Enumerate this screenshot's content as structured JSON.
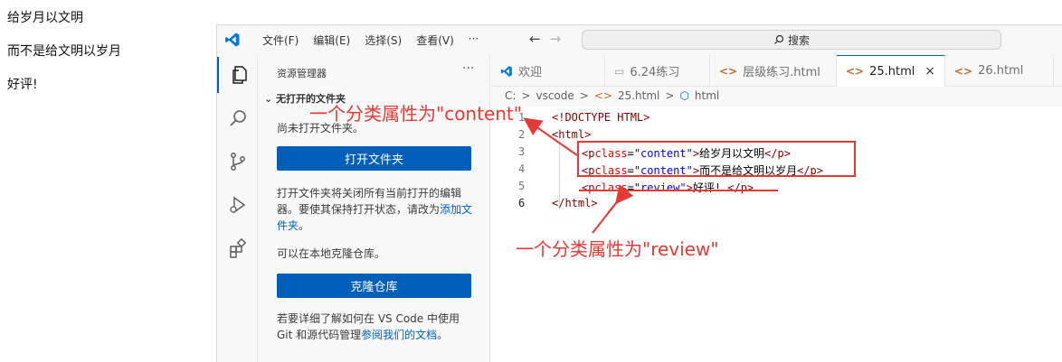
{
  "page": {
    "lines": [
      "给岁月以文明",
      "而不是给文明以岁月",
      "好评!"
    ]
  },
  "titlebar": {
    "menu": [
      "文件(F)",
      "编辑(E)",
      "选择(S)",
      "查看(V)",
      "···"
    ],
    "search_label": "搜索"
  },
  "activitybar": {
    "icons": [
      "explorer-icon",
      "search-icon",
      "source-control-icon",
      "run-debug-icon",
      "extensions-icon"
    ]
  },
  "sidebar": {
    "title": "资源管理器",
    "more": "···",
    "section": "无打开的文件夹",
    "no_folder_text": "尚未打开文件夹。",
    "open_folder_button": "打开文件夹",
    "info_text": "打开文件夹将关闭所有当前打开的编辑器。要使其保持打开状态，请改为",
    "add_folder_link": "添加文件夹",
    "add_folder_suffix": "。",
    "clone_text": "可以在本地克隆仓库。",
    "clone_button": "克隆仓库",
    "learn_text": "若要详细了解如何在 VS Code 中使用 Git 和源代码管理",
    "docs_link": "参阅我们的文档",
    "docs_suffix": "。"
  },
  "tabs": [
    {
      "label": "欢迎",
      "icon": "vscode-logo-icon",
      "active": false
    },
    {
      "label": "6.24练习",
      "icon": "file-icon",
      "active": false
    },
    {
      "label": "层级练习.html",
      "icon": "html-icon",
      "active": false
    },
    {
      "label": "25.html",
      "icon": "html-icon",
      "active": true,
      "close": "×"
    },
    {
      "label": "26.html",
      "icon": "html-icon",
      "active": false
    }
  ],
  "breadcrumb": [
    "C:",
    ">",
    "vscode",
    ">",
    "<>",
    "25.html",
    ">",
    "html"
  ],
  "editor": {
    "line_numbers": [
      "1",
      "2",
      "3",
      "4",
      "5",
      "6"
    ],
    "lines": [
      {
        "tag_open": "<!DOCTYPE HTML>",
        "attr": "",
        "eq": "",
        "val": "",
        "close": "",
        "text": "",
        "end": ""
      },
      {
        "tag_open": "<html>",
        "attr": "",
        "eq": "",
        "val": "",
        "close": "",
        "text": "",
        "end": ""
      },
      {
        "tag_open": "<p",
        "attr": "class",
        "eq": "=",
        "val": "\"content\"",
        "close": ">",
        "text": "给岁月以文明",
        "end": "</p>"
      },
      {
        "tag_open": "<p",
        "attr": "class",
        "eq": "=",
        "val": "\"content\"",
        "close": ">",
        "text": "而不是给文明以岁月",
        "end": "</p>"
      },
      {
        "tag_open": "<p",
        "attr": "class",
        "eq": "=",
        "val": "\"review\"",
        "close": ">",
        "text": "好评! ",
        "end": "</p>"
      },
      {
        "tag_open": "</html>",
        "attr": "",
        "eq": "",
        "val": "",
        "close": "",
        "text": "",
        "end": ""
      }
    ]
  },
  "annotations": {
    "content_label": "一个分类属性为\"content\"",
    "review_label": "一个分类属性为\"review\"",
    "color": "#e53935"
  }
}
